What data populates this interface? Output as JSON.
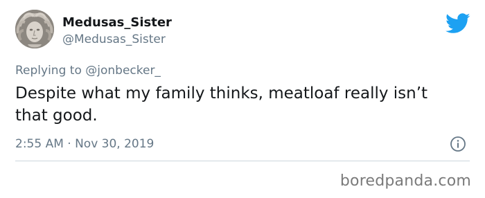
{
  "tweet": {
    "display_name": "Medusas_Sister",
    "handle": "@Medusas_Sister",
    "replying_to_label": "Replying to",
    "replying_to_handle": "@jonbecker_",
    "text": "Despite what my family thinks, meatloaf really isn’t that good.",
    "timestamp": "2:55 AM · Nov 30, 2019"
  },
  "icons": {
    "brand": "twitter-bird-icon",
    "info": "info-icon",
    "avatar": "medusa-sculpture-avatar"
  },
  "colors": {
    "twitter_blue": "#1da1f2",
    "secondary_text": "#657786",
    "primary_text": "#14171a",
    "divider": "#ccd6dd"
  },
  "watermark": {
    "text": "boredpanda.com"
  }
}
